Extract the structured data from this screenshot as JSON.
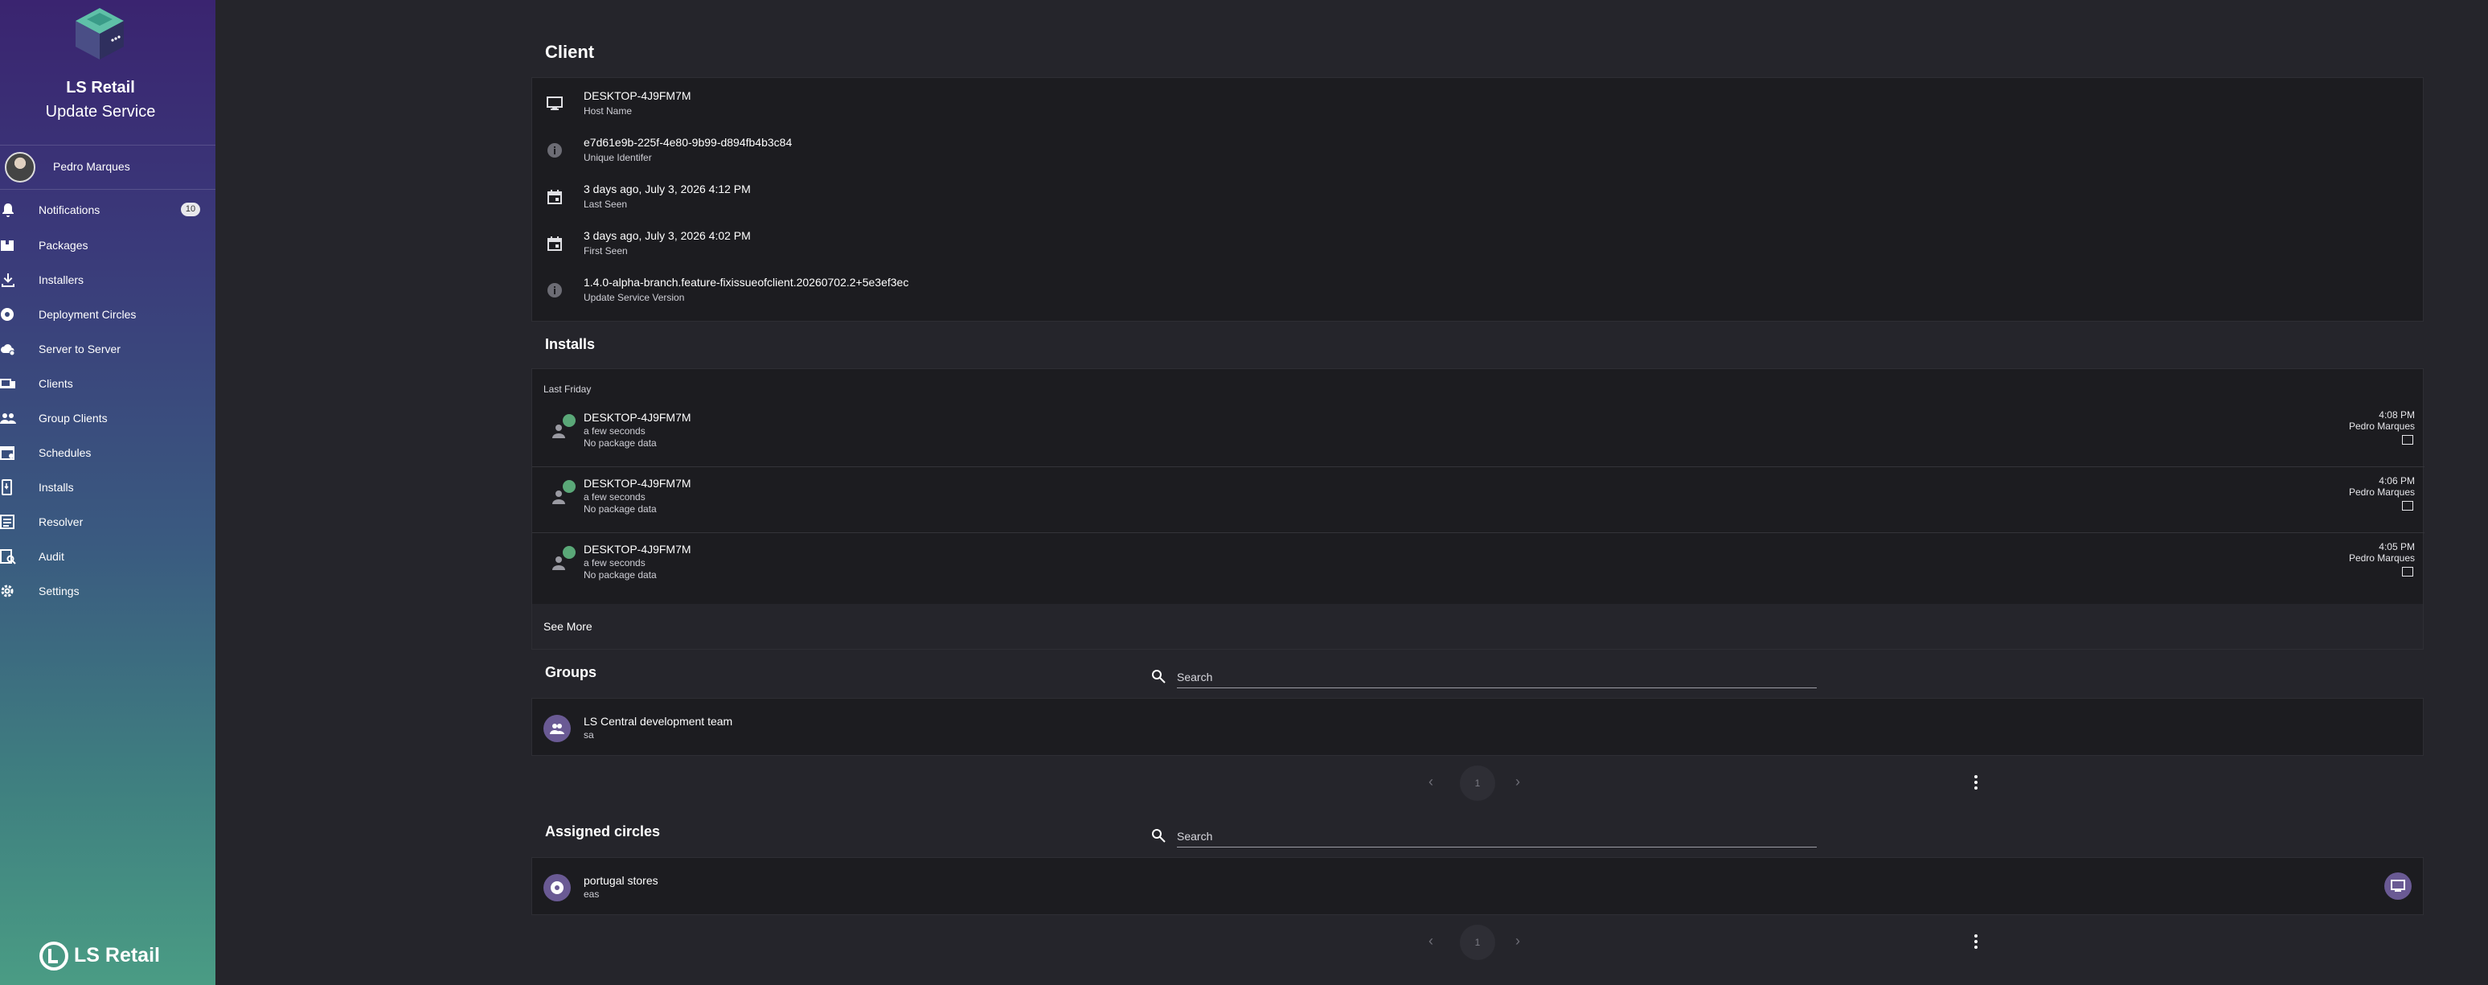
{
  "brand": {
    "title": "LS Retail",
    "subtitle": "Update Service",
    "footer_text": "LS Retail"
  },
  "user": {
    "name": "Pedro Marques"
  },
  "nav": [
    {
      "label": "Notifications",
      "icon": "bell-icon",
      "badge": "10"
    },
    {
      "label": "Packages",
      "icon": "package-icon"
    },
    {
      "label": "Installers",
      "icon": "download-icon"
    },
    {
      "label": "Deployment Circles",
      "icon": "circle-icon"
    },
    {
      "label": "Server to Server",
      "icon": "cloud-sync-icon"
    },
    {
      "label": "Clients",
      "icon": "devices-icon"
    },
    {
      "label": "Group Clients",
      "icon": "group-icon"
    },
    {
      "label": "Schedules",
      "icon": "calendar-icon"
    },
    {
      "label": "Installs",
      "icon": "phone-install-icon"
    },
    {
      "label": "Resolver",
      "icon": "list-icon"
    },
    {
      "label": "Audit",
      "icon": "audit-icon"
    },
    {
      "label": "Settings",
      "icon": "gear-icon"
    }
  ],
  "client": {
    "title": "Client",
    "rows": [
      {
        "value": "DESKTOP-4J9FM7M",
        "label": "Host Name",
        "icon": "monitor-icon"
      },
      {
        "value": "e7d61e9b-225f-4e80-9b99-d894fb4b3c84",
        "label": "Unique Identifer",
        "icon": "info-icon"
      },
      {
        "value": "3 days ago, July 3, 2026 4:12 PM",
        "label": "Last Seen",
        "icon": "calendar-icon"
      },
      {
        "value": "3 days ago, July 3, 2026 4:02 PM",
        "label": "First Seen",
        "icon": "calendar-icon"
      },
      {
        "value": "1.4.0-alpha-branch.feature-fixissueofclient.20260702.2+5e3ef3ec",
        "label": "Update Service Version",
        "icon": "info-icon"
      }
    ]
  },
  "installs": {
    "title": "Installs",
    "group_label": "Last Friday",
    "see_more": "See More",
    "items": [
      {
        "host": "DESKTOP-4J9FM7M",
        "duration": "a few seconds",
        "detail": "No package data",
        "time": "4:08 PM",
        "user": "Pedro Marques"
      },
      {
        "host": "DESKTOP-4J9FM7M",
        "duration": "a few seconds",
        "detail": "No package data",
        "time": "4:06 PM",
        "user": "Pedro Marques"
      },
      {
        "host": "DESKTOP-4J9FM7M",
        "duration": "a few seconds",
        "detail": "No package data",
        "time": "4:05 PM",
        "user": "Pedro Marques"
      }
    ]
  },
  "groups": {
    "title": "Groups",
    "search_placeholder": "Search",
    "items": [
      {
        "name": "LS Central development team",
        "sub": "sa"
      }
    ],
    "page": "1"
  },
  "circles": {
    "title": "Assigned circles",
    "search_placeholder": "Search",
    "items": [
      {
        "name": "portugal stores",
        "sub": "eas"
      }
    ],
    "page": "1"
  },
  "colors": {
    "accent": "#6a5a94",
    "success": "#5aa878",
    "card": "#1c1c20",
    "background": "#25252b"
  }
}
